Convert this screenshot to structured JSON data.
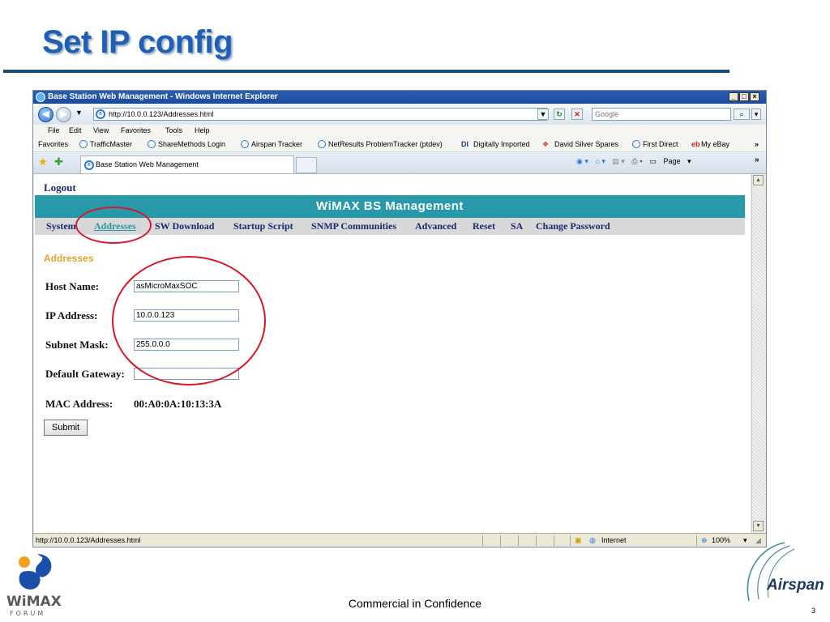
{
  "slide": {
    "title": "Set IP config",
    "footer": "Commercial in Confidence",
    "page_number": "3",
    "airspan_logo_text": "Airspan",
    "wimax_logo_text": "WiMAX",
    "wimax_logo_subtext": "FORUM"
  },
  "browser": {
    "window_title": "Base Station Web Management - Windows Internet Explorer",
    "address": "http://10.0.0.123/Addresses.html",
    "search_placeholder": "Google",
    "menu": [
      "File",
      "Edit",
      "View",
      "Favorites",
      "Tools",
      "Help"
    ],
    "favorites_label": "Favorites",
    "favorites": [
      "TrafficMaster",
      "ShareMethods Login",
      "Airspan Tracker",
      "NetResults ProblemTracker (ptdev)",
      "Digitally Imported",
      "David Silver Spares",
      "First Direct",
      "My eBay"
    ],
    "tab_title": "Base Station Web Management",
    "page_menu": "Page",
    "status_url": "http://10.0.0.123/Addresses.html",
    "zone": "Internet",
    "zoom": "100%"
  },
  "page": {
    "logout": "Logout",
    "banner": "WiMAX BS Management",
    "nav": [
      "System",
      "Addresses",
      "SW Download",
      "Startup Script",
      "SNMP Communities",
      "Advanced",
      "Reset",
      "SA",
      "Change Password"
    ],
    "active_nav": "Addresses",
    "section_title": "Addresses",
    "fields": {
      "host_name": {
        "label": "Host Name:",
        "value": "asMicroMaxSOC"
      },
      "ip_address": {
        "label": "IP Address:",
        "value": "10.0.0.123"
      },
      "subnet_mask": {
        "label": "Subnet Mask:",
        "value": "255.0.0.0"
      },
      "default_gateway": {
        "label": "Default Gateway:",
        "value": ""
      },
      "mac_address": {
        "label": "MAC Address:",
        "value": "00:A0:0A:10:13:3A"
      }
    },
    "submit_label": "Submit"
  },
  "colors": {
    "banner": "#2899a8",
    "title": "#1f5fb4",
    "annotation": "#d6182c",
    "section": "#e0a030"
  }
}
